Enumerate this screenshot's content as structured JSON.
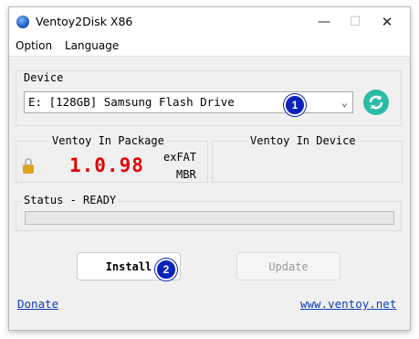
{
  "window": {
    "title": "Ventoy2Disk  X86"
  },
  "title_controls": {
    "minimize": "—",
    "maximize": "☐",
    "close": "✕"
  },
  "menu": {
    "option": "Option",
    "language": "Language"
  },
  "device": {
    "label": "Device",
    "selected": "E: [128GB] Samsung Flash Drive",
    "callout": "1"
  },
  "package": {
    "label": "Ventoy In Package",
    "version": "1.0.98",
    "filesystem": "exFAT",
    "partition_style": "MBR"
  },
  "in_device": {
    "label": "Ventoy In Device"
  },
  "status": {
    "text": "Status - READY",
    "progress": 0
  },
  "buttons": {
    "install": "Install",
    "install_callout": "2",
    "update": "Update"
  },
  "links": {
    "donate": "Donate",
    "website": "www.ventoy.net"
  },
  "colors": {
    "version": "#e00000",
    "refresh": "#2bbba6",
    "callout": "#0b23b8",
    "link": "#0b3eb8"
  }
}
